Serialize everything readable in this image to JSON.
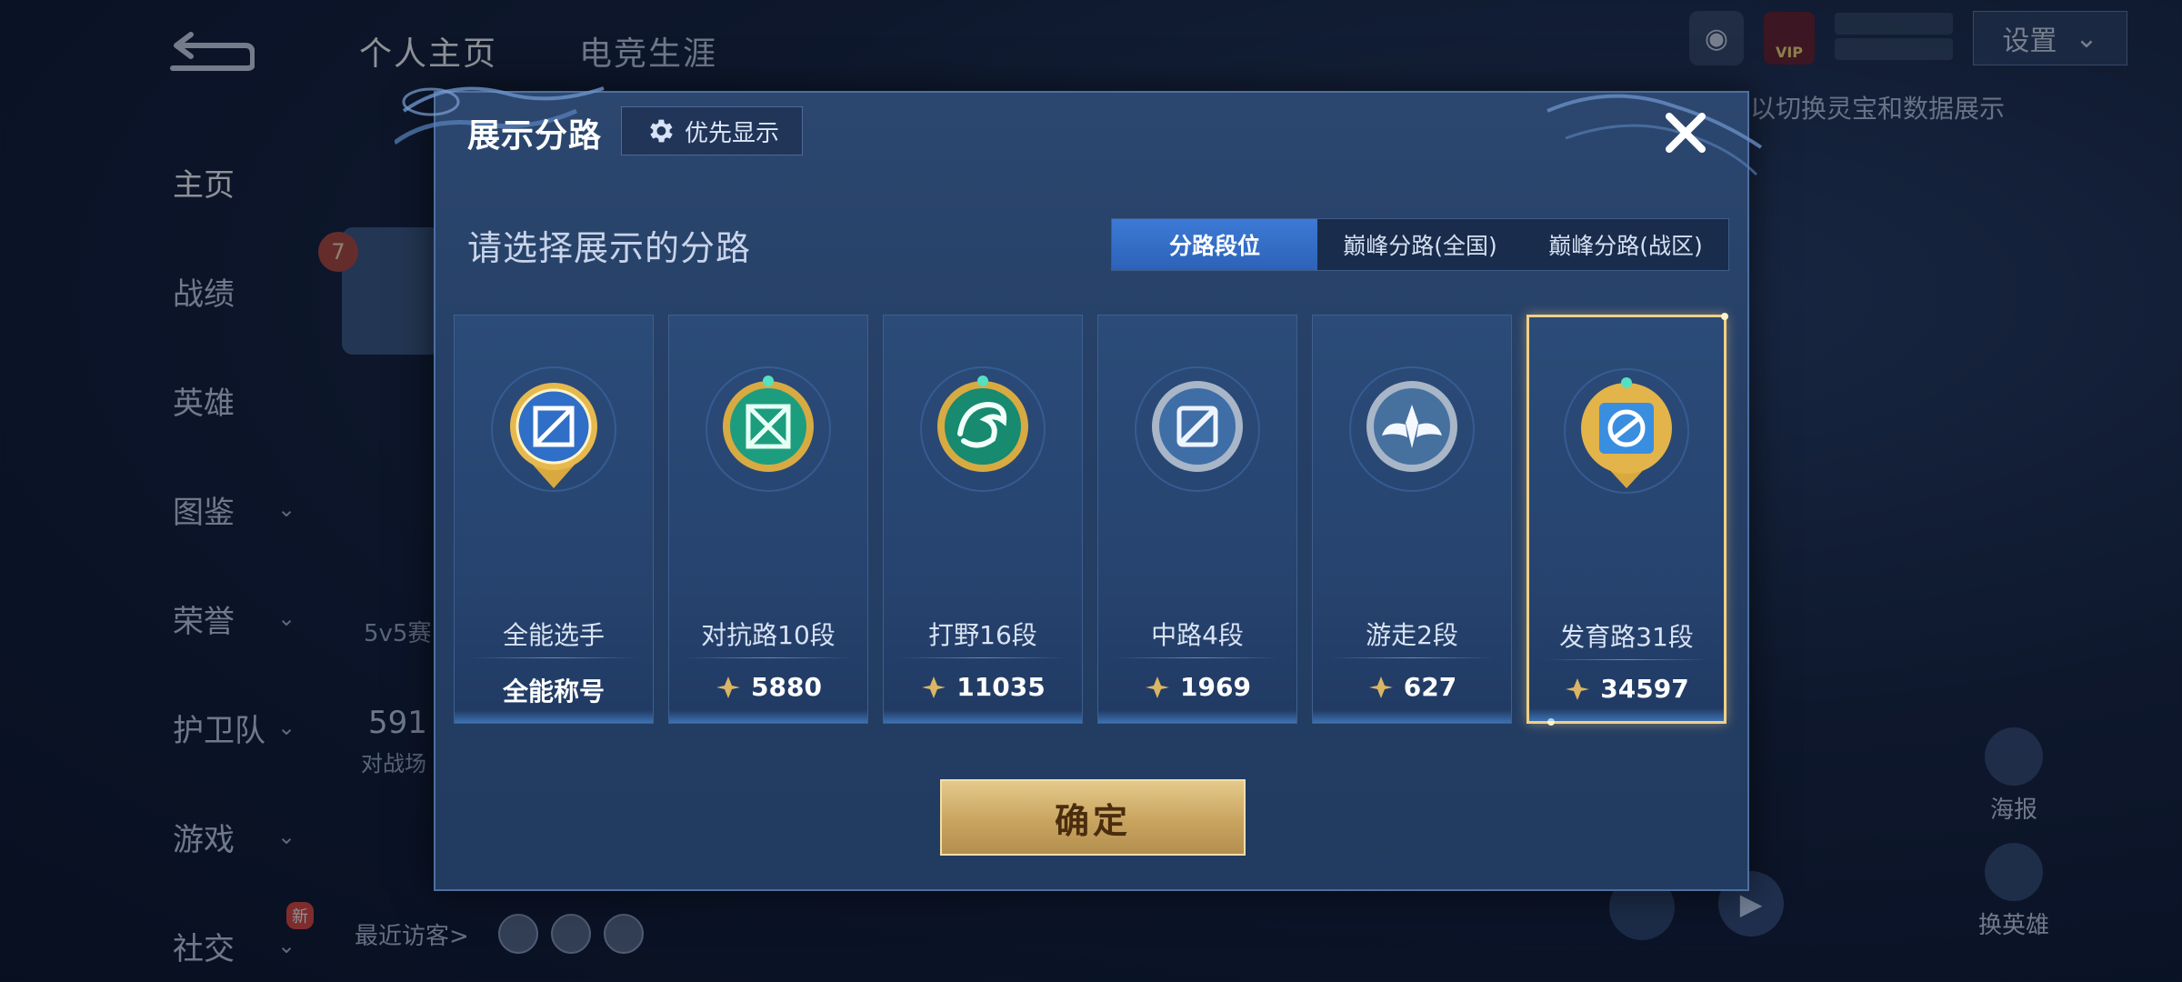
{
  "background": {
    "tabs": [
      {
        "label": "个人主页",
        "active": true
      },
      {
        "label": "电竞生涯",
        "active": false
      }
    ],
    "nav": [
      {
        "label": "主页",
        "active": true,
        "chevron": false
      },
      {
        "label": "战绩",
        "chevron": false
      },
      {
        "label": "英雄",
        "chevron": false
      },
      {
        "label": "图鉴",
        "chevron": true
      },
      {
        "label": "荣誉",
        "chevron": true
      },
      {
        "label": "护卫队",
        "chevron": true
      },
      {
        "label": "游戏",
        "chevron": true
      },
      {
        "label": "社交",
        "chevron": true,
        "badge": "新"
      }
    ],
    "settings_label": "设置",
    "vip_label": "VIP",
    "hint_text": "以切换灵宝和数据展示",
    "side_rank": "7",
    "side_text": "5v5赛",
    "side_num": "591",
    "side_text2": "对战场",
    "recent_visitors_label": "最近访客>",
    "poster_label": "海报",
    "swap_hero_label": "换英雄"
  },
  "modal": {
    "title": "展示分路",
    "priority_label": "优先显示",
    "subtitle": "请选择展示的分路",
    "tabs": [
      {
        "label": "分路段位",
        "active": true
      },
      {
        "label": "巅峰分路(全国)",
        "active": false
      },
      {
        "label": "巅峰分路(战区)",
        "active": false
      }
    ],
    "cards": [
      {
        "name": "全能选手",
        "value": "全能称号",
        "icon": "all-round-badge",
        "has_points": false,
        "selected": false
      },
      {
        "name": "对抗路10段",
        "value": "5880",
        "icon": "clash-lane-badge",
        "has_points": true,
        "selected": false
      },
      {
        "name": "打野16段",
        "value": "11035",
        "icon": "jungle-badge",
        "has_points": true,
        "selected": false
      },
      {
        "name": "中路4段",
        "value": "1969",
        "icon": "mid-lane-badge",
        "has_points": true,
        "selected": false
      },
      {
        "name": "游走2段",
        "value": "627",
        "icon": "roam-badge",
        "has_points": true,
        "selected": false
      },
      {
        "name": "发育路31段",
        "value": "34597",
        "icon": "farm-lane-badge",
        "has_points": true,
        "selected": true
      }
    ],
    "confirm_label": "确定"
  },
  "colors": {
    "accent_blue": "#2d62b8",
    "gold": "#c9a460",
    "selected_border": "#f0cf86"
  }
}
